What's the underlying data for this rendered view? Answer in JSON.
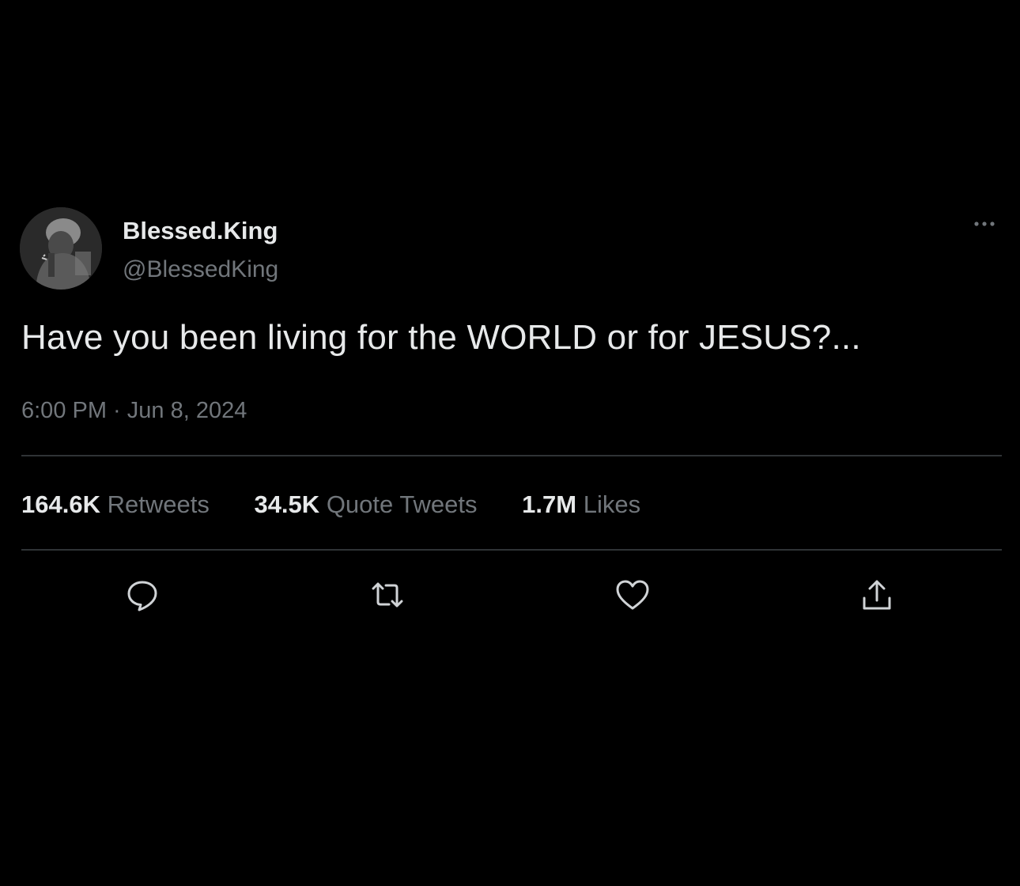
{
  "user": {
    "display_name": "Blessed.King",
    "handle": "@BlessedKing",
    "avatar_icon": "profile-photo"
  },
  "tweet": {
    "text": "Have you been living for the WORLD or for JESUS?...",
    "timestamp": "6:00 PM · Jun 8, 2024"
  },
  "stats": {
    "retweets": {
      "count": "164.6K",
      "label": "Retweets"
    },
    "quote_tweets": {
      "count": "34.5K",
      "label": "Quote Tweets"
    },
    "likes": {
      "count": "1.7M",
      "label": "Likes"
    }
  },
  "actions": [
    {
      "name": "reply",
      "icon": "speech-bubble-icon"
    },
    {
      "name": "retweet",
      "icon": "retweet-arrows-icon"
    },
    {
      "name": "like",
      "icon": "heart-icon"
    },
    {
      "name": "share",
      "icon": "share-upload-icon"
    }
  ],
  "menu": {
    "icon": "more-dots-icon"
  },
  "colors": {
    "background": "#000000",
    "primary_text": "#e7e9ea",
    "secondary_text": "#71767b",
    "divider": "#2f3336"
  }
}
